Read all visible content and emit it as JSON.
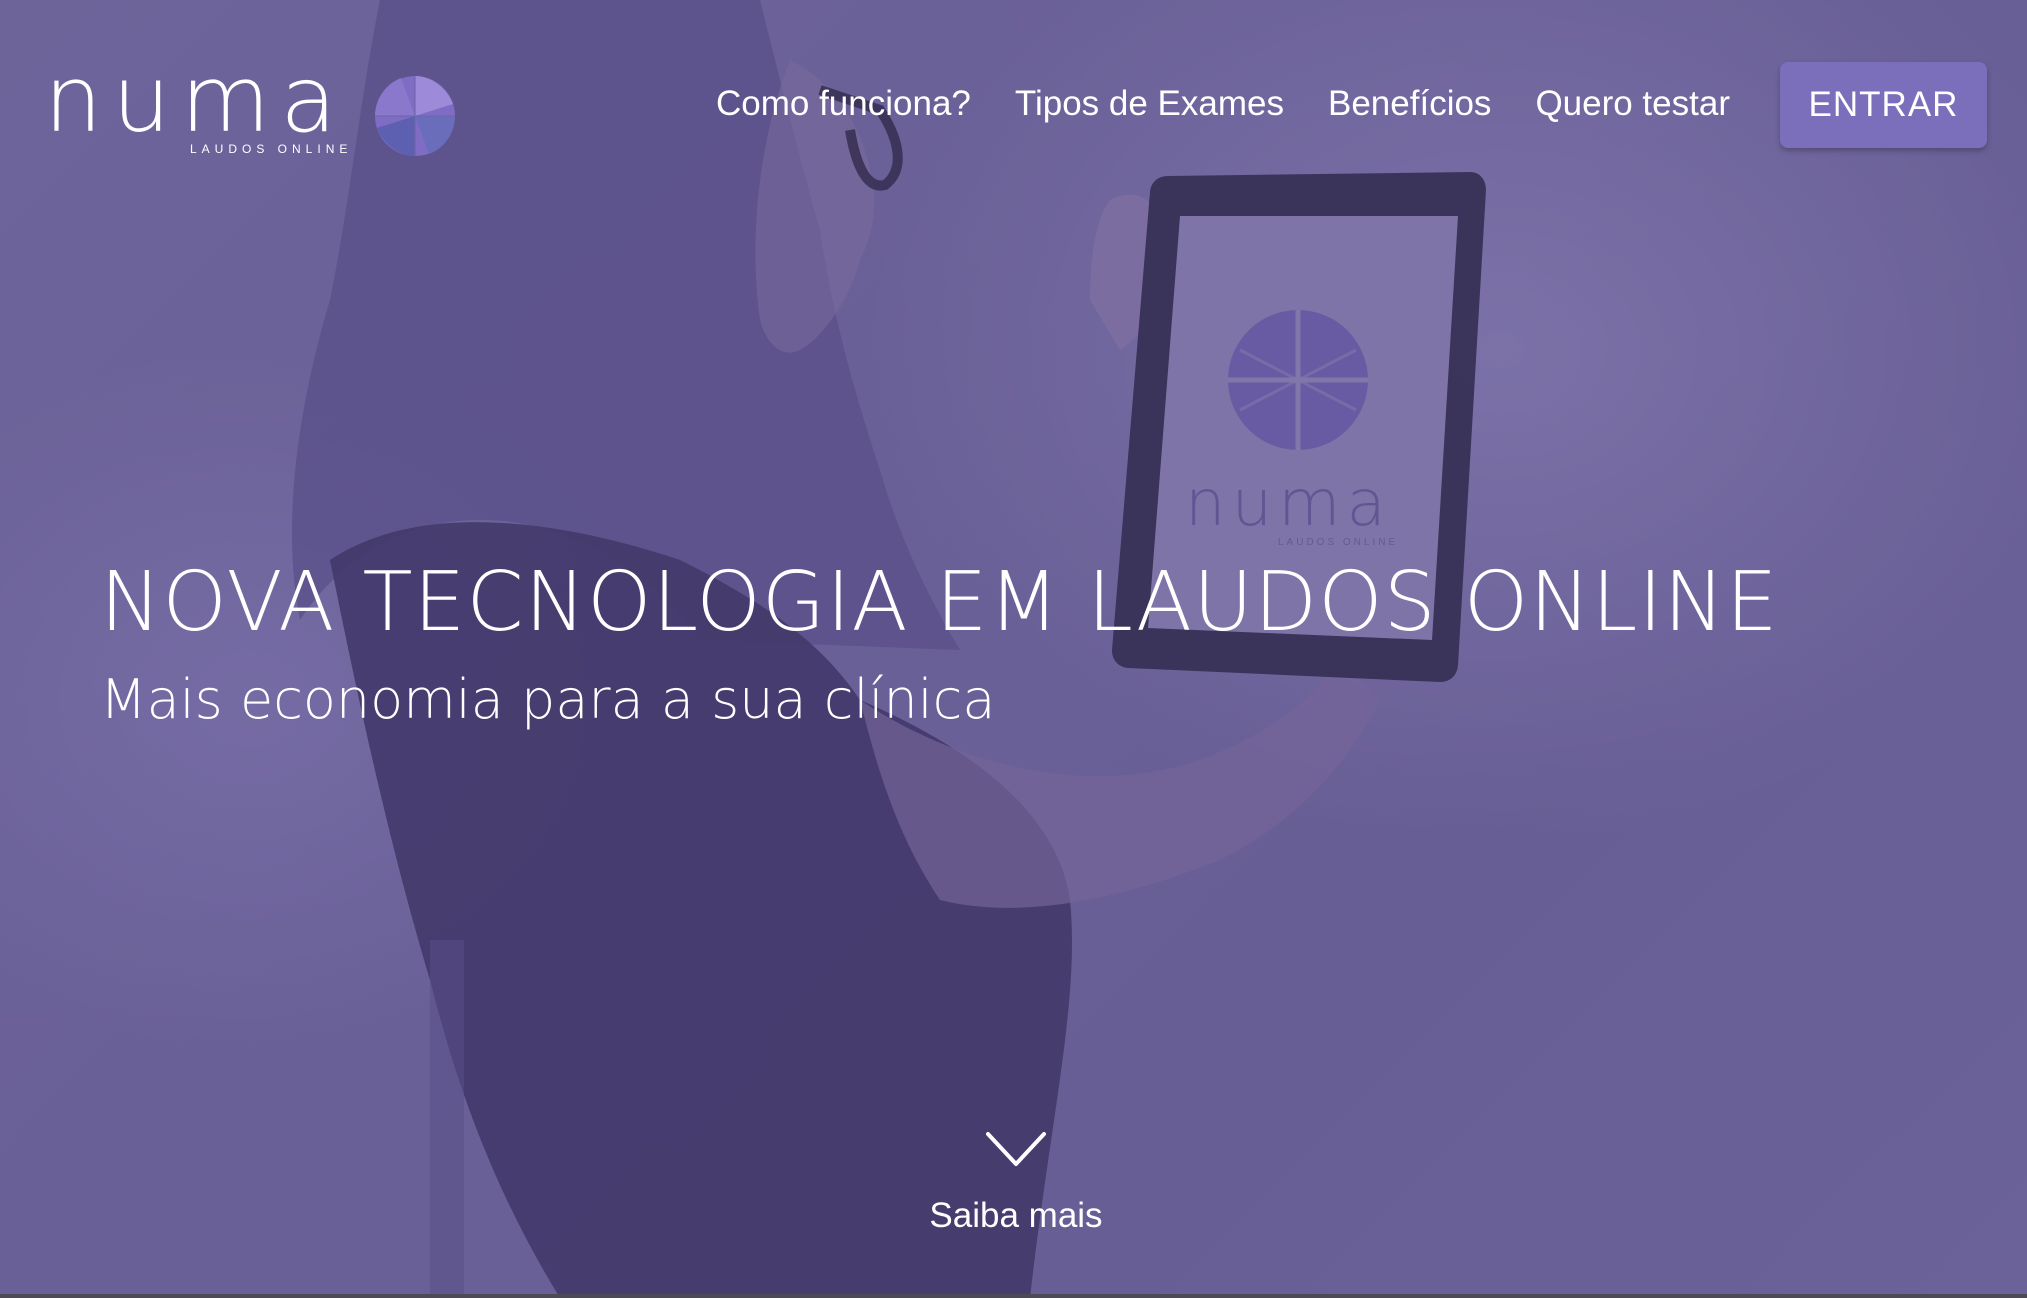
{
  "header": {
    "logo": {
      "wordmark": "numa",
      "tagline": "LAUDOS ONLINE",
      "mark_icon": "numa-flower-logo-icon"
    },
    "nav": [
      {
        "label": "Como funciona?"
      },
      {
        "label": "Tipos de Exames"
      },
      {
        "label": "Benefícios"
      },
      {
        "label": "Quero testar"
      }
    ],
    "cta_label": "ENTRAR"
  },
  "hero": {
    "title": "NOVA TECNOLOGIA EM LAUDOS ONLINE",
    "subtitle": "Mais economia para a sua clínica",
    "scroll_label": "Saiba mais",
    "scroll_icon": "chevron-down-icon",
    "tablet_logo": {
      "wordmark": "numa",
      "tagline": "LAUDOS ONLINE"
    }
  },
  "colors": {
    "overlay": "#6b6399",
    "button": "#7b6fbb",
    "text": "#ffffff"
  }
}
